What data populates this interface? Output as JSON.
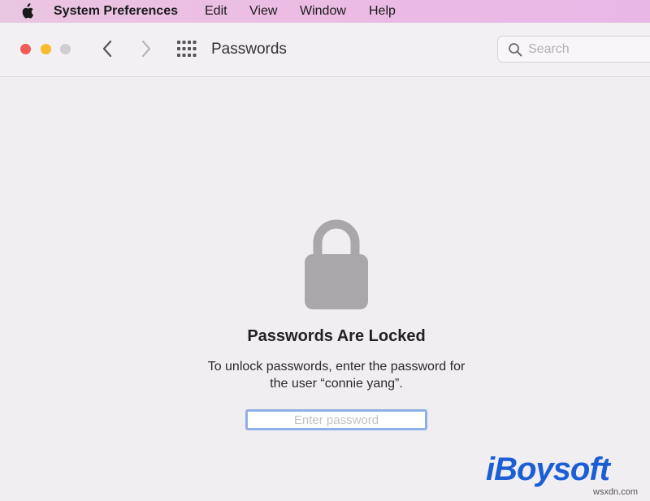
{
  "menubar": {
    "app_name": "System Preferences",
    "items": [
      "Edit",
      "View",
      "Window",
      "Help"
    ]
  },
  "window": {
    "title": "Passwords",
    "search": {
      "placeholder": "Search",
      "value": ""
    }
  },
  "locked": {
    "title": "Passwords Are Locked",
    "message_line1": "To unlock passwords, enter the password for",
    "message_line2": "the user “connie yang”.",
    "password_placeholder": "Enter password"
  },
  "watermark": {
    "brand": "iBoysoft",
    "site": "wsxdn.com"
  },
  "icons": {
    "apple": "apple-logo-icon",
    "back": "chevron-left-icon",
    "forward": "chevron-right-icon",
    "grid": "grid-icon",
    "search": "search-icon",
    "lock": "lock-icon"
  },
  "colors": {
    "close": "#f15c56",
    "minimize": "#f7bc2e",
    "zoom_disabled": "#cfcdd0",
    "focus_ring": "#8fb0e6",
    "brand": "#1c5fd4"
  }
}
